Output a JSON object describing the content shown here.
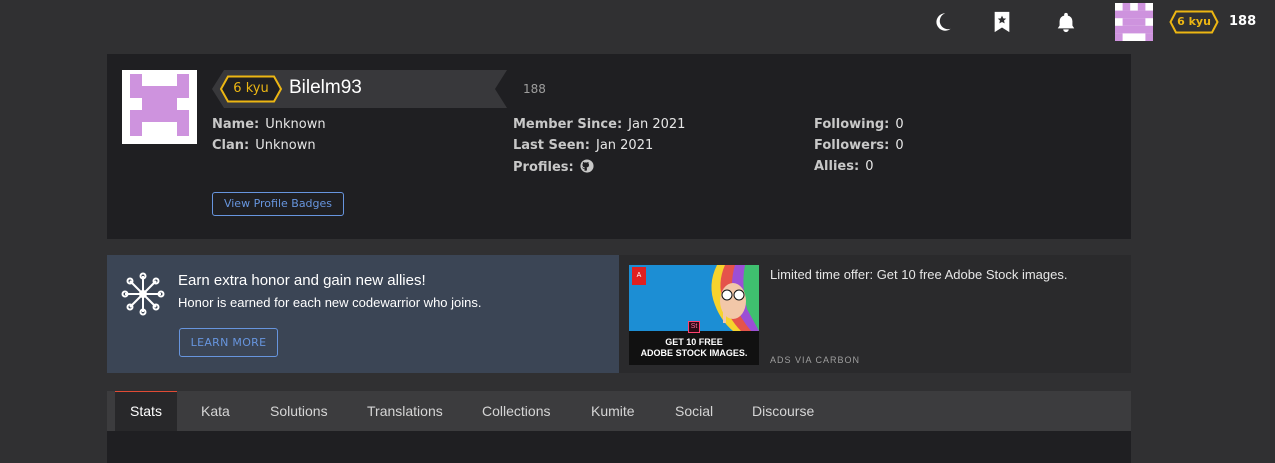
{
  "topbar": {
    "rank": "6 kyu",
    "honor": "188",
    "icons": [
      "moon-icon",
      "bookmark-icon",
      "bell-icon"
    ]
  },
  "profile": {
    "rank": "6 kyu",
    "username": "Bilelm93",
    "honor": "188",
    "left_stats": [
      {
        "label": "Name:",
        "value": "Unknown"
      },
      {
        "label": "Clan:",
        "value": "Unknown"
      }
    ],
    "mid_stats": [
      {
        "label": "Member Since:",
        "value": "Jan 2021"
      },
      {
        "label": "Last Seen:",
        "value": "Jan 2021"
      },
      {
        "label": "Profiles:",
        "value": ""
      }
    ],
    "right_stats": [
      {
        "label": "Following:",
        "value": "0"
      },
      {
        "label": "Followers:",
        "value": "0"
      },
      {
        "label": "Allies:",
        "value": "0"
      }
    ],
    "badges_button": "View Profile Badges"
  },
  "referral": {
    "title": "Earn extra honor and gain new allies!",
    "subtitle": "Honor is earned for each new codewarrior who joins.",
    "button": "LEARN MORE"
  },
  "ad": {
    "logo": "A",
    "badge": "St",
    "cta_line1": "GET 10 FREE",
    "cta_line2": "ADOBE STOCK IMAGES.",
    "text": "Limited time offer: Get 10 free Adobe Stock images.",
    "via": "ADS VIA CARBON"
  },
  "tabs": [
    {
      "label": "Stats",
      "active": true
    },
    {
      "label": "Kata"
    },
    {
      "label": "Solutions"
    },
    {
      "label": "Translations"
    },
    {
      "label": "Collections"
    },
    {
      "label": "Kumite"
    },
    {
      "label": "Social"
    },
    {
      "label": "Discourse"
    }
  ],
  "colors": {
    "accent": "#ecb613",
    "link": "#6795de",
    "active_tab": "#e14b35",
    "avatar": "#ce93de"
  }
}
